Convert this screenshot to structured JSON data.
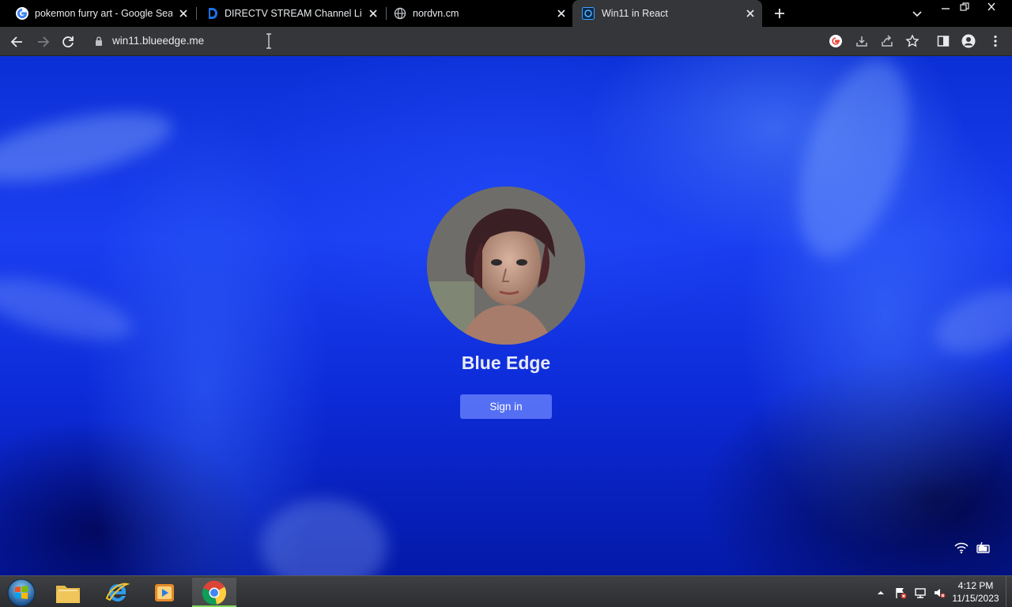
{
  "browser": {
    "tabs": [
      {
        "title": "pokemon furry art - Google Sear",
        "icon": "google-icon"
      },
      {
        "title": "DIRECTV STREAM Channel Lineup",
        "icon": "directv-icon"
      },
      {
        "title": "nordvn.cm",
        "icon": "globe-icon"
      },
      {
        "title": "Win11 in React",
        "icon": "win11-icon",
        "active": true
      }
    ],
    "url": "win11.blueedge.me"
  },
  "lockscreen": {
    "username": "Blue Edge",
    "signin_label": "Sign in"
  },
  "taskbar": {
    "apps": [
      "windows-explorer",
      "internet-explorer",
      "media-player",
      "google-chrome"
    ],
    "clock_time": "4:12 PM",
    "clock_date": "11/15/2023"
  },
  "colors": {
    "accent_blue": "#1a3ff0",
    "signin_button": "#6e87ff",
    "tab_active": "#35363a"
  }
}
